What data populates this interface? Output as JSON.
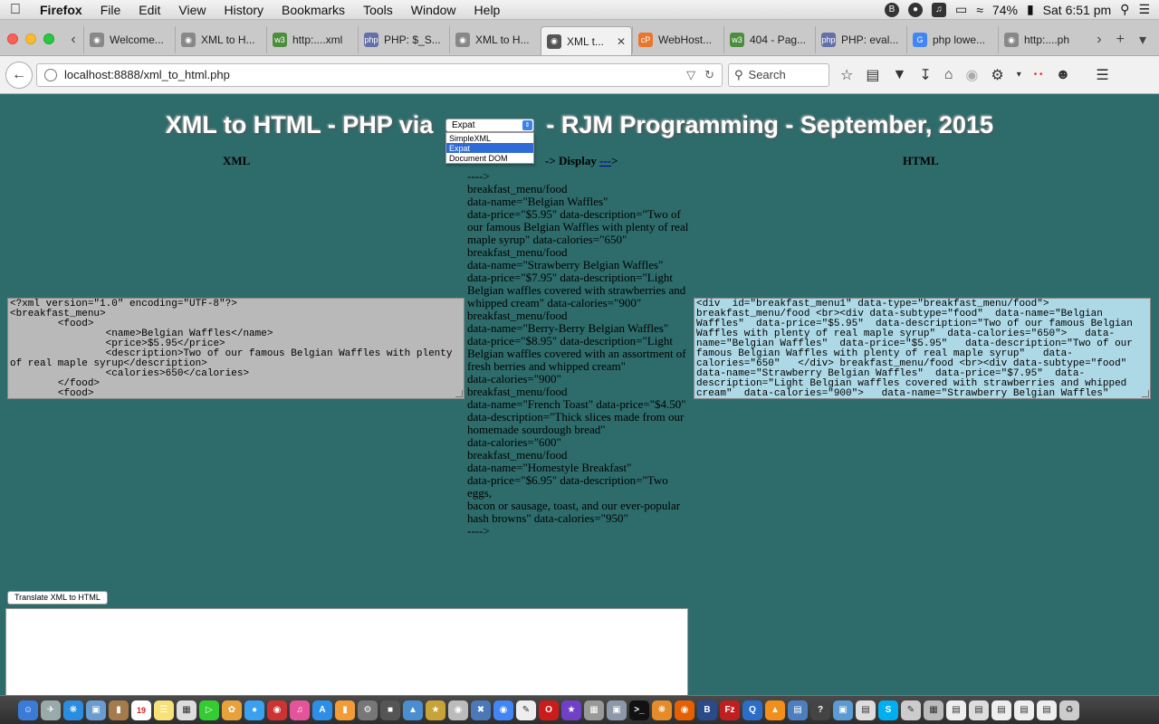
{
  "menubar": {
    "apple": "",
    "app_name": "Firefox",
    "items": [
      "File",
      "Edit",
      "View",
      "History",
      "Bookmarks",
      "Tools",
      "Window",
      "Help"
    ],
    "battery": "74%",
    "clock": "Sat 6:51 pm"
  },
  "tabs": [
    {
      "label": "Welcome...",
      "icon": "globe-icon",
      "active": false
    },
    {
      "label": "XML to H...",
      "icon": "globe-icon",
      "active": false
    },
    {
      "label": "http:....xml",
      "icon": "w3-icon",
      "active": false
    },
    {
      "label": "PHP: $_S...",
      "icon": "php-icon",
      "active": false
    },
    {
      "label": "XML to H...",
      "icon": "globe-icon",
      "active": false
    },
    {
      "label": "XML t...",
      "icon": "globe-icon",
      "active": true
    },
    {
      "label": "WebHost...",
      "icon": "cpanel-icon",
      "active": false
    },
    {
      "label": "404 - Pag...",
      "icon": "w3-icon",
      "active": false
    },
    {
      "label": "PHP: eval...",
      "icon": "php-icon",
      "active": false
    },
    {
      "label": "php lowe...",
      "icon": "google-icon",
      "active": false
    },
    {
      "label": "http:....ph",
      "icon": "globe-icon",
      "active": false
    }
  ],
  "navbar": {
    "url": "localhost:8888/xml_to_html.php",
    "search_placeholder": "Search"
  },
  "page": {
    "title_before": "XML to HTML - PHP via",
    "title_after": "- RJM Programming - September, 2015",
    "parser_select": {
      "selected": "Expat",
      "options": [
        "SimpleXML",
        "Expat",
        "Document DOM"
      ]
    },
    "col_xml": "XML",
    "col_display_suffix": "-> Display",
    "col_display_link": "---",
    "col_display_end": ">",
    "col_html": "HTML",
    "xml_text": "<?xml version=\"1.0\" encoding=\"UTF-8\"?>\n<breakfast_menu>\n        <food>\n                <name>Belgian Waffles</name>\n                <price>$5.95</price>\n                <description>Two of our famous Belgian Waffles with plenty of real maple syrup</description>\n                <calories>650</calories>\n        </food>\n        <food>",
    "html_text": "<div  id=\"breakfast_menu1\" data-type=\"breakfast_menu/food\"> breakfast_menu/food <br><div data-subtype=\"food\"  data-name=\"Belgian Waffles\"  data-price=\"$5.95\"  data-description=\"Two of our famous Belgian Waffles with plenty of real maple syrup\"  data-calories=\"650\">   data-name=\"Belgian Waffles\"  data-price=\"$5.95\"   data-description=\"Two of our famous Belgian Waffles with plenty of real maple syrup\"   data-calories=\"650\"   </div> breakfast_menu/food <br><div data-subtype=\"food\"  data-name=\"Strawberry Belgian Waffles\"  data-price=\"$7.95\"  data-description=\"Light Belgian waffles covered with strawberries and whipped cream\"  data-calories=\"900\">   data-name=\"Strawberry Belgian Waffles\"   data-price=\"$7.95\"   data-description=\"Light Belgian waffles",
    "display_lines": [
      "---->",
      "breakfast_menu/food",
      "data-name=\"Belgian Waffles\"",
      "data-price=\"$5.95\" data-description=\"Two of",
      "our famous Belgian Waffles with plenty of real",
      "maple syrup\" data-calories=\"650\"",
      "breakfast_menu/food",
      "data-name=\"Strawberry Belgian Waffles\"",
      "data-price=\"$7.95\" data-description=\"Light",
      "Belgian waffles covered with strawberries and",
      "whipped cream\" data-calories=\"900\"",
      "breakfast_menu/food",
      "data-name=\"Berry-Berry Belgian Waffles\"",
      "data-price=\"$8.95\" data-description=\"Light",
      "Belgian waffles covered with an assortment of",
      "fresh berries and whipped cream\"",
      "data-calories=\"900\"",
      "breakfast_menu/food",
      "data-name=\"French Toast\" data-price=\"$4.50\"",
      "data-description=\"Thick slices made from our",
      "homemade sourdough bread\"",
      "data-calories=\"600\"",
      "breakfast_menu/food",
      "data-name=\"Homestyle Breakfast\"",
      "data-price=\"$6.95\" data-description=\"Two eggs,",
      "bacon or sausage, toast, and our ever-popular",
      "hash browns\" data-calories=\"950\"",
      "---->"
    ],
    "translate_button": "Translate XML to HTML"
  },
  "dock": {
    "calendar_day": "19"
  },
  "colors": {
    "page_bg": "#2e6c6c",
    "xml_bg": "#b9b9b9",
    "html_bg": "#add8e6",
    "dropdown_selected": "#2f6bd7"
  }
}
